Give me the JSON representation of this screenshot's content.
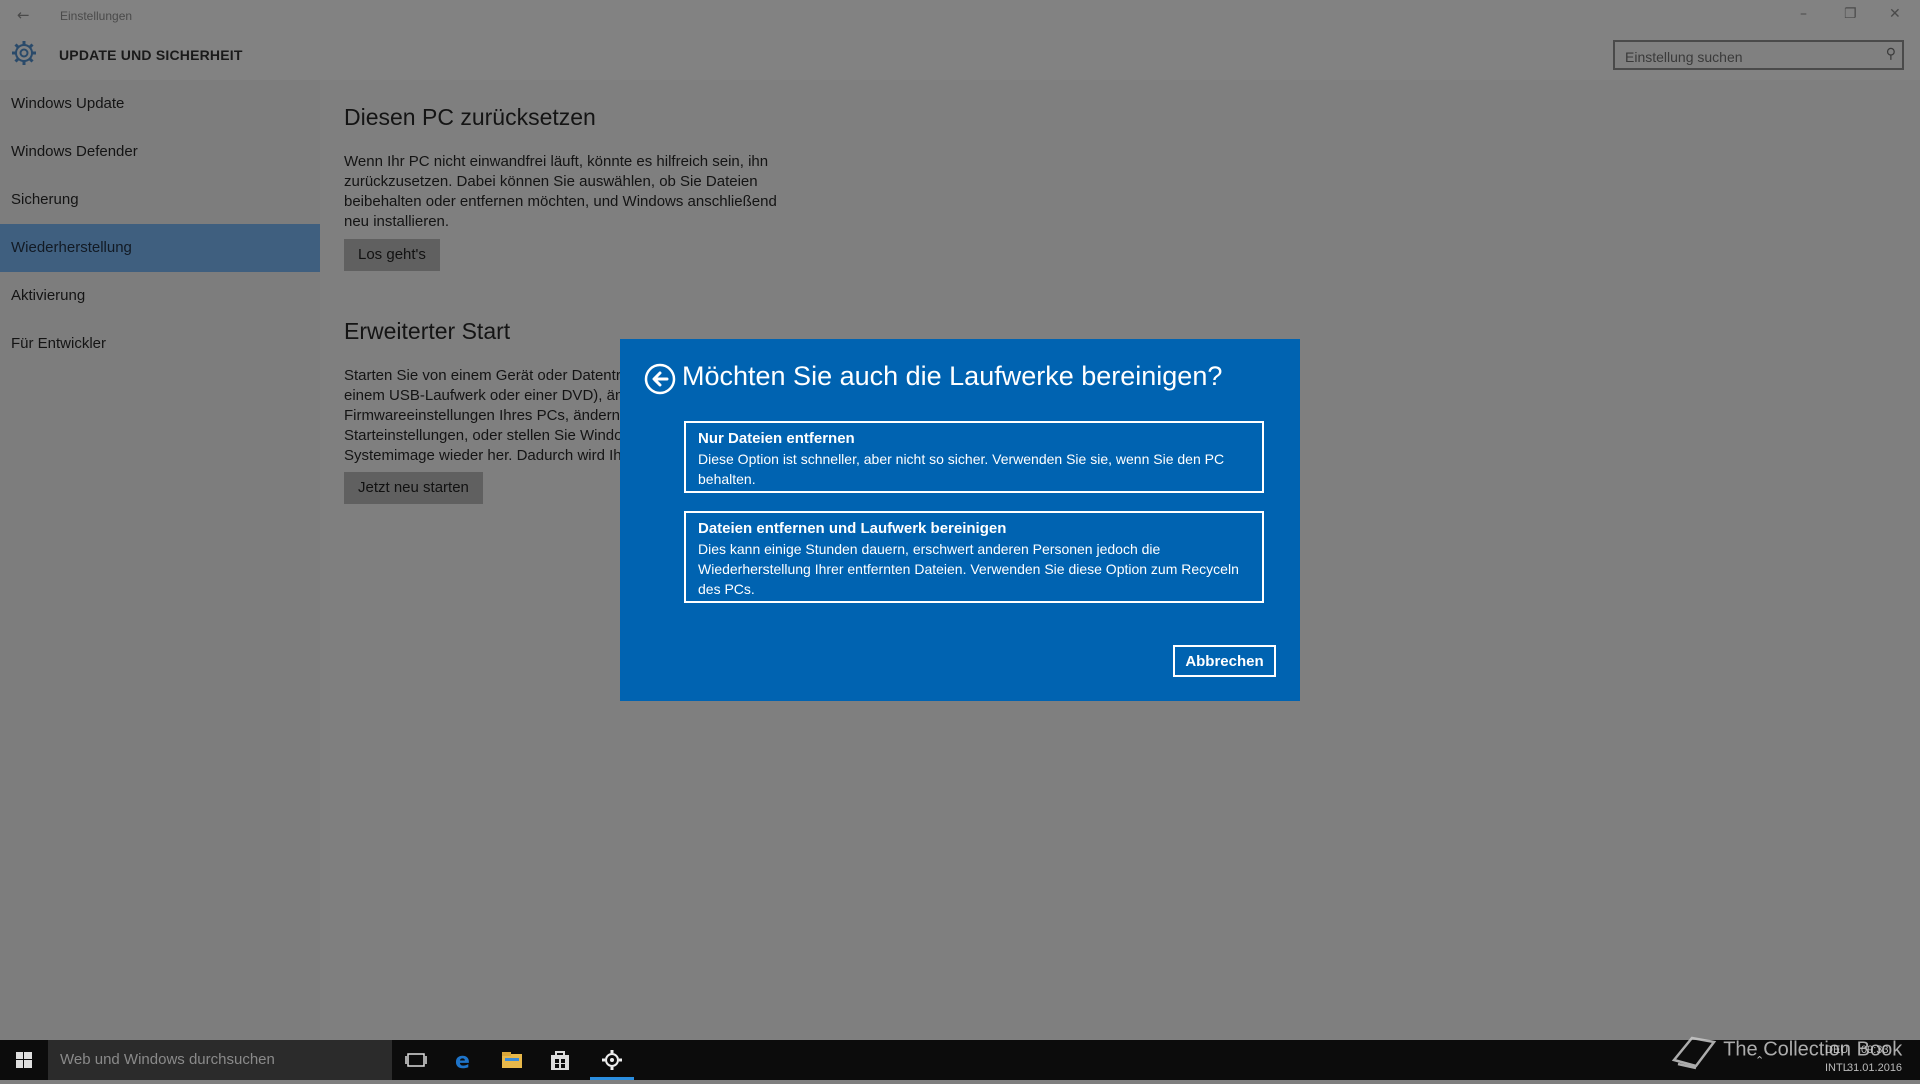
{
  "window": {
    "back_glyph": "←",
    "title": "Einstellungen",
    "minimize": "–",
    "maximize": "❐",
    "close": "✕",
    "section_title": "UPDATE UND SICHERHEIT",
    "section_icon": "gear-icon"
  },
  "search": {
    "placeholder": "Einstellung suchen",
    "icon": "search-icon"
  },
  "sidebar": {
    "items": [
      {
        "label": "Windows Update"
      },
      {
        "label": "Windows Defender"
      },
      {
        "label": "Sicherung"
      },
      {
        "label": "Wiederherstellung"
      },
      {
        "label": "Aktivierung"
      },
      {
        "label": "Für Entwickler"
      }
    ],
    "active_index": 3
  },
  "main": {
    "reset": {
      "heading": "Diesen PC zurücksetzen",
      "line1": "Wenn Ihr PC nicht einwandfrei läuft, könnte es hilfreich sein, ihn",
      "line2": "zurückzusetzen. Dabei können Sie auswählen, ob Sie Dateien",
      "line3": "beibehalten oder entfernen möchten, und Windows anschließend",
      "line4": "neu installieren.",
      "button": "Los geht's"
    },
    "advanced": {
      "heading": "Erweiterter Start",
      "line1": "Starten Sie von einem Gerät oder Datenträ",
      "line2": "einem USB-Laufwerk oder einer DVD), änd",
      "line3": "Firmwareeinstellungen Ihres PCs, ändern S",
      "line4": "Starteinstellungen, oder stellen Sie Windo",
      "line5": "Systemimage wieder her. Dadurch wird Ih",
      "button": "Jetzt neu starten"
    }
  },
  "dialog": {
    "title": "Möchten Sie auch die Laufwerke bereinigen?",
    "back_icon": "back-arrow-circle-icon",
    "option1": {
      "title": "Nur Dateien entfernen",
      "desc_line1": "Diese Option ist schneller, aber nicht so sicher. Verwenden Sie sie, wenn Sie den PC",
      "desc_line2": "behalten."
    },
    "option2": {
      "title": "Dateien entfernen und Laufwerk bereinigen",
      "desc_line1": "Dies kann einige Stunden dauern, erschwert anderen Personen jedoch die",
      "desc_line2": "Wiederherstellung Ihrer entfernten Dateien. Verwenden Sie diese Option zum Recyceln",
      "desc_line3": "des PCs."
    },
    "cancel": "Abbrechen",
    "accent": "#0063b1"
  },
  "taskbar": {
    "search_placeholder": "Web und Windows durchsuchen",
    "icons": [
      "windows-start-icon",
      "task-view-icon",
      "edge-icon",
      "file-explorer-icon",
      "store-icon",
      "settings-gear-icon"
    ],
    "tray_lang_top": "DEU",
    "tray_lang_bottom": "INTL",
    "time": "09:33",
    "date": "31.01.2016",
    "watermark": "The Collection Book"
  }
}
